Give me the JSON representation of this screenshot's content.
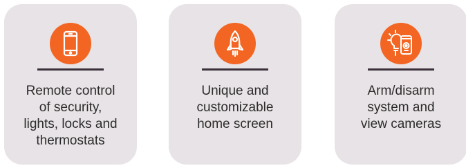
{
  "features": [
    {
      "icon": "smartphone-icon",
      "label": "Remote control\nof security,\nlights, locks and\nthermostats"
    },
    {
      "icon": "rocket-icon",
      "label": "Unique and\ncustomizable\nhome screen"
    },
    {
      "icon": "lightbulb-phone-camera-icon",
      "label": "Arm/disarm\nsystem and\nview cameras"
    }
  ],
  "colors": {
    "card_bg": "#e8e3e6",
    "accent": "#f26522",
    "divider": "#3a2f3a",
    "text": "#2b2b2b"
  }
}
